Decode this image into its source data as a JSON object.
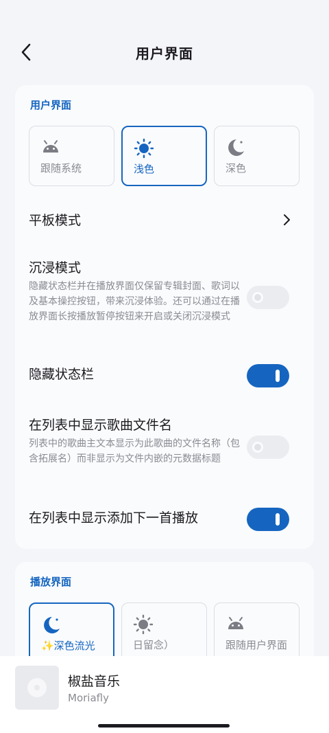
{
  "header": {
    "title": "用户界面"
  },
  "ui_section": {
    "title": "用户界面",
    "options": [
      {
        "label": "跟随系统",
        "icon": "android-icon",
        "selected": false
      },
      {
        "label": "浅色",
        "icon": "sun-icon",
        "selected": true
      },
      {
        "label": "深色",
        "icon": "moon-icon",
        "selected": false
      }
    ]
  },
  "settings": {
    "tablet": {
      "title": "平板模式"
    },
    "immersive": {
      "title": "沉浸模式",
      "desc": "隐藏状态栏并在播放界面仅保留专辑封面、歌词以及基本操控按钮，带来沉浸体验。还可以通过在播放界面长按播放暂停按钮来开启或关闭沉浸模式",
      "enabled": false
    },
    "hide_status": {
      "title": "隐藏状态栏",
      "enabled": true
    },
    "show_filename": {
      "title": "在列表中显示歌曲文件名",
      "desc": "列表中的歌曲主文本显示为此歌曲的文件名称（包含拓展名）而非显示为文件内嵌的元数据标题",
      "enabled": false
    },
    "show_add_next": {
      "title": "在列表中显示添加下一首播放",
      "enabled": true
    }
  },
  "play_section": {
    "title": "播放界面",
    "options": [
      {
        "label": "✨深色流光",
        "icon": "moon-icon",
        "selected": true
      },
      {
        "label": "日留念）",
        "icon": "sun-icon",
        "selected": false
      },
      {
        "label": "跟随用户界面",
        "icon": "android-icon",
        "selected": false
      }
    ]
  },
  "player": {
    "title": "椒盐音乐",
    "artist": "Moriafly"
  },
  "colors": {
    "accent": "#1565c0",
    "background": "#f4f5f9",
    "card": "#fafbfd"
  }
}
